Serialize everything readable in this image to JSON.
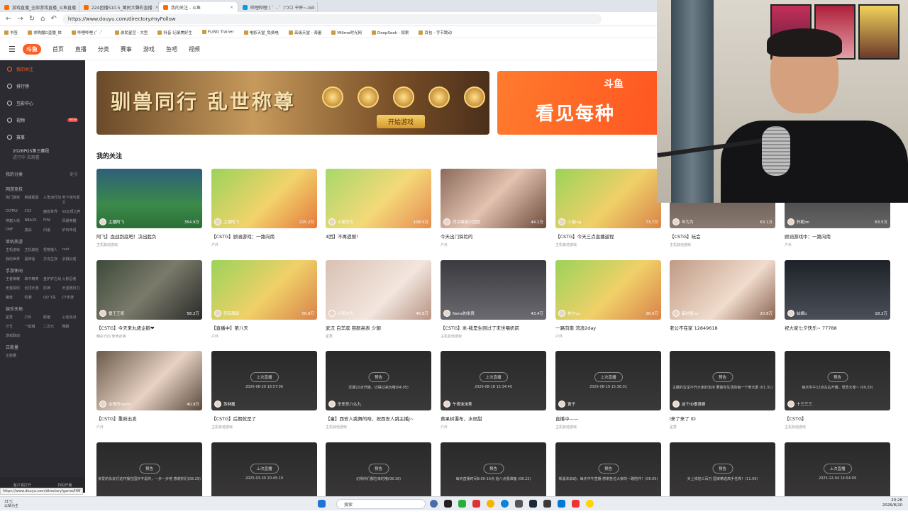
{
  "browser": {
    "tabs": [
      {
        "title": "游戏直播_全部游戏直播_斗鱼直播",
        "active": false
      },
      {
        "title": "224团播S10.5_萬民大聲彩直播",
        "active": false
      },
      {
        "title": "我的关注 - 斗鱼",
        "active": true
      },
      {
        "title": "哔哩哔哩 ( ゜- ゜)つロ 干杯~-bili",
        "active": false
      }
    ],
    "url": "https://www.douyu.com/directory/myFollow",
    "bookmarks": [
      "书签",
      "求购魔G直播_体",
      "哔哩哔哩 (゜-゜",
      "游民星空 - 大型",
      "抖音-记录美好生",
      "FLiNG Trainer",
      "电影天堂_免费电",
      "高级天堂 - 海量",
      "Milime时光网",
      "DeepSeek - 探索",
      "百包 - 字节跳动"
    ]
  },
  "site": {
    "logo": "斗鱼",
    "nav": [
      "首页",
      "直播",
      "分类",
      "赛事",
      "游戏",
      "鱼吧",
      "视频"
    ]
  },
  "sidebar": {
    "items": [
      {
        "label": "我的关注",
        "active": true
      },
      {
        "label": "排行榜"
      },
      {
        "label": "互影中心"
      },
      {
        "label": "视频",
        "badge": "NEW"
      },
      {
        "label": "赛事"
      }
    ],
    "event": {
      "title": "2026PGS第三赛段",
      "sub": "进行中 去观看"
    },
    "my_categories": "我的分类",
    "more": "更多",
    "groups": [
      {
        "title": "网游竞技",
        "tags": [
          "热门游戏",
          "英雄联盟",
          "三角洲行动",
          "地下城与勇士",
          "DOTA2",
          "CS2",
          "魔兽世界",
          "lol云顶之弈",
          "穿越火线",
          "NBA2K",
          "FIFA",
          "风暴英雄",
          "DNF",
          "激战",
          "问道",
          "炉石传说"
        ]
      },
      {
        "title": "单机热游",
        "tags": [
          "主机游戏",
          "主机其他",
          "怪物猎人",
          "rust",
          "我的世界",
          "黑神话",
          "方舟生存",
          "杀戮尖塔"
        ]
      },
      {
        "title": "手游休闲",
        "tags": [
          "王者荣耀",
          "和平精英",
          "金铲铲之战",
          "火影忍者",
          "无畏契约",
          "云顶手游",
          "原神",
          "天涯明月刀",
          "魔兽",
          "鸣潮",
          "QQ飞车",
          "CF手游"
        ]
      },
      {
        "title": "娱乐天地",
        "tags": [
          "星秀",
          "户外",
          "颜值",
          "心动派对",
          "才艺",
          "一起唱",
          "二次元",
          "舞蹈",
          "游戏联动"
        ]
      },
      {
        "title": "正能量",
        "tags": [
          "正能量"
        ]
      }
    ],
    "footer": [
      "客户端打开",
      "扫码开播"
    ]
  },
  "banners": {
    "left": {
      "headline": "驯兽同行 乱世称尊",
      "button": "开始游戏"
    },
    "right": {
      "logo": "斗鱼",
      "headline": "看见每种"
    }
  },
  "section_title": "我的关注",
  "cards": [
    {
      "streamer": "主播阿飞",
      "viewers": "354.9万",
      "title": "阿飞】血战到底吧！决出胜负",
      "category": "主机其他游戏"
    },
    {
      "streamer": "主播阿飞",
      "viewers": "215.2万",
      "title": "【CSTG】顾涵游戏：一路向南",
      "category": "户外"
    },
    {
      "streamer": "小鹿贝贝",
      "viewers": "108.5万",
      "title": "4团】不再遗憾!",
      "category": ""
    },
    {
      "streamer": "西瓜猫猫小团团",
      "viewers": "44.1万",
      "title": "今天出门探险的",
      "category": "户外"
    },
    {
      "streamer": "小涵ing",
      "viewers": "73.7万",
      "title": "【CSTG】今天三点直播返程",
      "category": "主机其他游戏"
    },
    {
      "streamer": "年为为",
      "viewers": "63.1万",
      "title": "【CSTG】玩会",
      "category": "主机其他游戏"
    },
    {
      "streamer": "轩妮on",
      "viewers": "63.5万",
      "title": "顾涵游戏中：一路向南",
      "category": "户外"
    },
    {
      "streamer": "雷王王哥",
      "viewers": "58.2万",
      "title": "【CSTG】今天来丸佬企鹅❤",
      "category": "精彩方向 使命召唤"
    },
    {
      "streamer": "芭菲甜甜",
      "viewers": "56.8万",
      "title": "【直播中】第八天",
      "category": "户外"
    },
    {
      "streamer": "小燕大大",
      "viewers": "46.8万",
      "title": "武汉 白羊座 容颜高表 少御",
      "category": "星秀"
    },
    {
      "streamer": "Nana的米窝",
      "viewers": "43.4万",
      "title": "【CSTG】米-我是生则过了末世喂奶前",
      "category": "主机其他游戏"
    },
    {
      "streamer": "林夕yu",
      "viewers": "36.0万",
      "title": "一路向南 流浪2day",
      "category": "户外"
    },
    {
      "streamer": "蛋挞酱ou",
      "viewers": "20.8万",
      "title": "老公不在家 12849618",
      "category": ""
    },
    {
      "streamer": "姑娘o",
      "viewers": "18.2万",
      "title": "祝大家七夕快乐~ 77788",
      "category": ""
    },
    {
      "streamer": "余想的room",
      "viewers": "40.9万",
      "title": "【CSTG】重新出发",
      "category": "户外"
    },
    {
      "streamer": "苏林酱",
      "status": "上次直播",
      "time": "2026-08-20 18:57:06",
      "title": "【CSTG】后期就是了",
      "category": "主机其他游戏"
    },
    {
      "streamer": "乐乐乐八么九",
      "status": "预告",
      "time": "近期22点开播，记得过来玩哦(04.05)",
      "title": "【童】西安人跳舞的哈，祝西安人跳主播J~",
      "category": "主机其他游戏"
    },
    {
      "streamer": "午夜沫沫茶",
      "status": "上次直播",
      "time": "2026-08-18 15:34:40",
      "title": "黄果树瀑布，水很甜",
      "category": "户外"
    },
    {
      "streamer": "寅子",
      "status": "上次直播",
      "time": "2026-08-19 15:36:01",
      "title": "直播中——",
      "category": "主机其他游戏"
    },
    {
      "streamer": "这个ID很浪费",
      "status": "预告",
      "time": "主播的宝宝不开大家的支持 要做你生活的每一个笑元素 (01.31)",
      "title": "l来了来了 ID",
      "category": "星秀"
    },
    {
      "streamer": "十三三三",
      "status": "预告",
      "time": "每天中午12点左右开播，想念大家~ (09.20)",
      "title": "【CSTG】",
      "category": "主机其他游戏"
    },
    {
      "streamer": "",
      "status": "预告",
      "time": "亲爱的永友们这开播在国外不是的，一步一步地 感谢你们(08.29)",
      "title": "",
      "category": ""
    },
    {
      "streamer": "",
      "status": "上次直播",
      "time": "2025-03-30 20:45:19",
      "title": "",
      "category": ""
    },
    {
      "streamer": "",
      "status": "预告",
      "time": "记得你们都在来的哦(08.16)",
      "title": "",
      "category": ""
    },
    {
      "streamer": "",
      "status": "预告",
      "time": "每天直播时间8:00-10点 给八点我准备 (08.22)",
      "title": "",
      "category": ""
    },
    {
      "streamer": "",
      "status": "预告",
      "time": "新版本启动，每天中午直播 感谢各位大家的一路陪伴！(06.05)",
      "title": "",
      "category": ""
    },
    {
      "streamer": "",
      "status": "预告",
      "time": "天上掉馅三百万 国家精选高手任高！(11.09)",
      "title": "",
      "category": ""
    },
    {
      "streamer": "",
      "status": "上次直播",
      "time": "2025-12-04 14:54:09",
      "title": "",
      "category": ""
    }
  ],
  "status_url": "https://www.douyu.com/directory/game/HW",
  "taskbar": {
    "weather_temp": "31°C",
    "weather_desc": "以晴为主",
    "search": "搜索",
    "time": "20:28",
    "date": "2026/8/20"
  },
  "colors": {
    "accent": "#ff5d23",
    "sidebar_bg": "#2b2b31"
  }
}
